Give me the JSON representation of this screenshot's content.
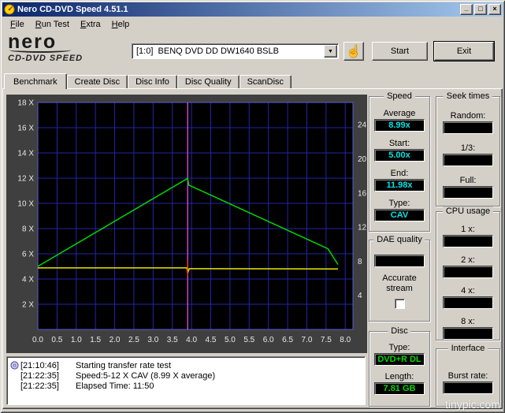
{
  "window": {
    "title": "Nero CD-DVD Speed 4.51.1",
    "menu": [
      "File",
      "Run Test",
      "Extra",
      "Help"
    ],
    "controls": {
      "minimize": "_",
      "maximize": "□",
      "close": "×"
    }
  },
  "logo": {
    "line1": "nero",
    "line2": "CD-DVD SPEED"
  },
  "toolbar": {
    "drive_selector": "[1:0]  BENQ DVD DD DW1640 BSLB",
    "dropdown_arrow": "▼",
    "hand_icon": "☝",
    "start_button": "Start",
    "exit_button": "Exit"
  },
  "tabs": [
    {
      "label": "Benchmark",
      "active": true
    },
    {
      "label": "Create Disc",
      "active": false
    },
    {
      "label": "Disc Info",
      "active": false
    },
    {
      "label": "Disc Quality",
      "active": false
    },
    {
      "label": "ScanDisc",
      "active": false
    }
  ],
  "chart_data": {
    "type": "line",
    "x_unit": "GB",
    "xlim": [
      0,
      8.2
    ],
    "ylim_left": [
      0,
      18
    ],
    "right_axis_max": 26.6,
    "x_tick_labels": [
      "0.0",
      "0.5",
      "1.0",
      "1.5",
      "2.0",
      "2.5",
      "3.0",
      "3.5",
      "4.0",
      "4.5",
      "5.0",
      "5.5",
      "6.0",
      "6.5",
      "7.0",
      "7.5",
      "8.0"
    ],
    "left_tick_labels": [
      "2 X",
      "4 X",
      "6 X",
      "8 X",
      "10 X",
      "12 X",
      "14 X",
      "16 X",
      "18 X"
    ],
    "right_tick_labels": [
      "4",
      "8",
      "12",
      "16",
      "20",
      "24"
    ],
    "series": [
      {
        "name": "read-speed-curve",
        "color": "#00d800",
        "points": [
          [
            0,
            5.0
          ],
          [
            3.9,
            11.98
          ],
          [
            3.93,
            11.45
          ],
          [
            7.55,
            6.4
          ],
          [
            7.81,
            5.15
          ]
        ]
      },
      {
        "name": "rotation-speed-curve",
        "color": "#e8e800",
        "points": [
          [
            0,
            4.88
          ],
          [
            3.88,
            4.88
          ],
          [
            3.9,
            4.45
          ],
          [
            3.94,
            4.82
          ],
          [
            7.81,
            4.8
          ]
        ]
      }
    ],
    "layer_break_cursor": {
      "x": 3.9,
      "color": "#cc44cc"
    },
    "layer_break_tick": {
      "x": 3.9,
      "y_from": 4.2,
      "y_to": 5.45,
      "color": "#ff3333"
    },
    "grid_color": "#2424aa",
    "frame_color": "#5a5ad8",
    "plot_bg": "#000000",
    "panel_bg": "#3f3f3f",
    "tick_text_color": "#e8e8e8"
  },
  "panels": {
    "speed": {
      "title": "Speed",
      "value_color": "#00e5e5",
      "fields": [
        {
          "label": "Average",
          "value": "8.99x"
        },
        {
          "label": "Start:",
          "value": "5.00x"
        },
        {
          "label": "End:",
          "value": "11.98x"
        },
        {
          "label": "Type:",
          "value": "CAV"
        }
      ]
    },
    "dae_quality": {
      "title": "DAE quality",
      "value": "",
      "accurate_line1": "Accurate",
      "accurate_line2": "stream",
      "checkbox_checked": false
    },
    "disc": {
      "title": "Disc",
      "value_color": "#00dc00",
      "fields": [
        {
          "label": "Type:",
          "value": "DVD+R DL"
        },
        {
          "label": "Length:",
          "value": "7.81 GB"
        }
      ]
    },
    "seek_times": {
      "title": "Seek times",
      "fields": [
        {
          "label": "Random:",
          "value": ""
        },
        {
          "label": "1/3:",
          "value": ""
        },
        {
          "label": "Full:",
          "value": ""
        }
      ]
    },
    "cpu_usage": {
      "title": "CPU usage",
      "fields": [
        {
          "label": "1 x:",
          "value": ""
        },
        {
          "label": "2 x:",
          "value": ""
        },
        {
          "label": "4 x:",
          "value": ""
        },
        {
          "label": "8 x:",
          "value": ""
        }
      ]
    },
    "interface": {
      "title": "Interface",
      "fields": [
        {
          "label": "Burst rate:",
          "value": ""
        }
      ]
    }
  },
  "log": {
    "entries": [
      {
        "time": "[21:10:46]",
        "text": "Starting transfer rate test"
      },
      {
        "time": "[21:22:35]",
        "text": "Speed:5-12 X CAV (8.99 X average)"
      },
      {
        "time": "[21:22:35]",
        "text": "Elapsed Time: 11:50"
      }
    ]
  },
  "watermark": "tinypic.com",
  "colors": {
    "titlebar_gradient_start": "#0a246a",
    "titlebar_gradient_end": "#a6caf0",
    "window_bg": "#d4d0c8"
  }
}
